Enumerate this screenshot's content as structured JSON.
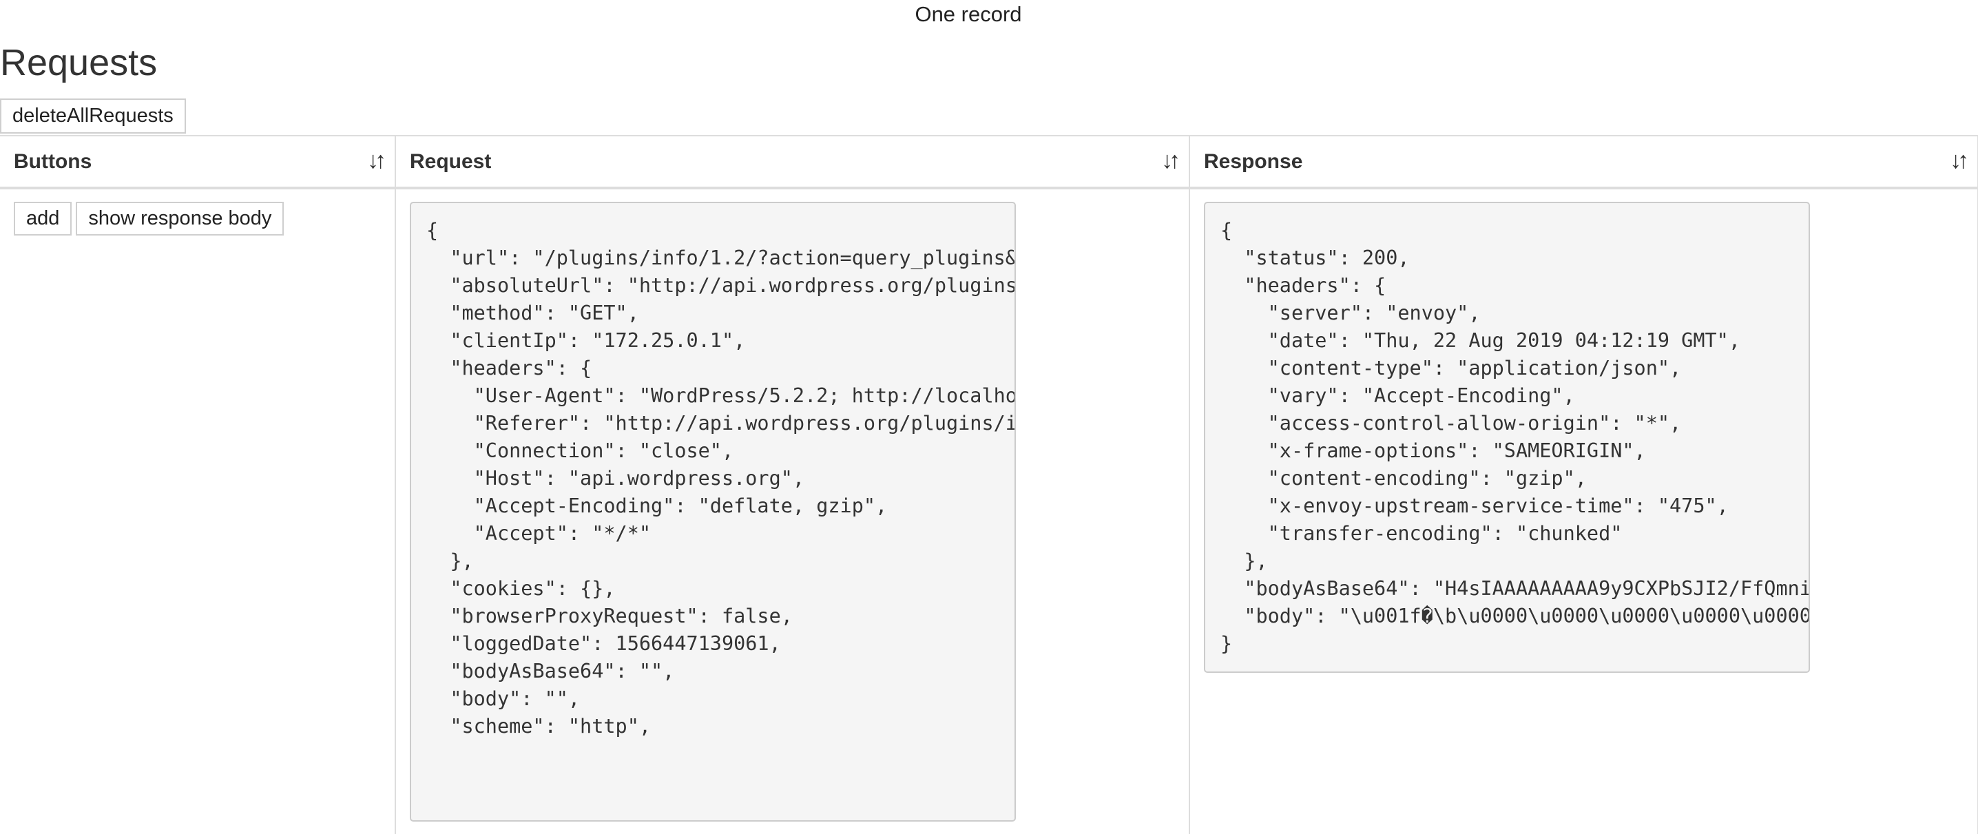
{
  "header": {
    "record_count": "One record",
    "title": "Requests",
    "delete_all_label": "deleteAllRequests"
  },
  "table": {
    "columns": [
      {
        "label": "Buttons",
        "sort_icon": "sort-arrows-icon"
      },
      {
        "label": "Request",
        "sort_icon": "sort-arrows-icon"
      },
      {
        "label": "Response",
        "sort_icon": "sort-arrows-icon"
      }
    ],
    "rows": [
      {
        "buttons": {
          "add_label": "add",
          "show_body_label": "show response body"
        },
        "request_json": "{\n  \"url\": \"/plugins/info/1.2/?action=query_plugins&\n  \"absoluteUrl\": \"http://api.wordpress.org/plugins\n  \"method\": \"GET\",\n  \"clientIp\": \"172.25.0.1\",\n  \"headers\": {\n    \"User-Agent\": \"WordPress/5.2.2; http://localho\n    \"Referer\": \"http://api.wordpress.org/plugins/i\n    \"Connection\": \"close\",\n    \"Host\": \"api.wordpress.org\",\n    \"Accept-Encoding\": \"deflate, gzip\",\n    \"Accept\": \"*/*\"\n  },\n  \"cookies\": {},\n  \"browserProxyRequest\": false,\n  \"loggedDate\": 1566447139061,\n  \"bodyAsBase64\": \"\",\n  \"body\": \"\",\n  \"scheme\": \"http\",",
        "response_json": "{\n  \"status\": 200,\n  \"headers\": {\n    \"server\": \"envoy\",\n    \"date\": \"Thu, 22 Aug 2019 04:12:19 GMT\",\n    \"content-type\": \"application/json\",\n    \"vary\": \"Accept-Encoding\",\n    \"access-control-allow-origin\": \"*\",\n    \"x-frame-options\": \"SAMEORIGIN\",\n    \"content-encoding\": \"gzip\",\n    \"x-envoy-upstream-service-time\": \"475\",\n    \"transfer-encoding\": \"chunked\"\n  },\n  \"bodyAsBase64\": \"H4sIAAAAAAAAA9y9CXPbSJI2/FfQmni\n  \"body\": \"\\u001f�\\b\\u0000\\u0000\\u0000\\u0000\\u0000\n}"
      }
    ]
  }
}
